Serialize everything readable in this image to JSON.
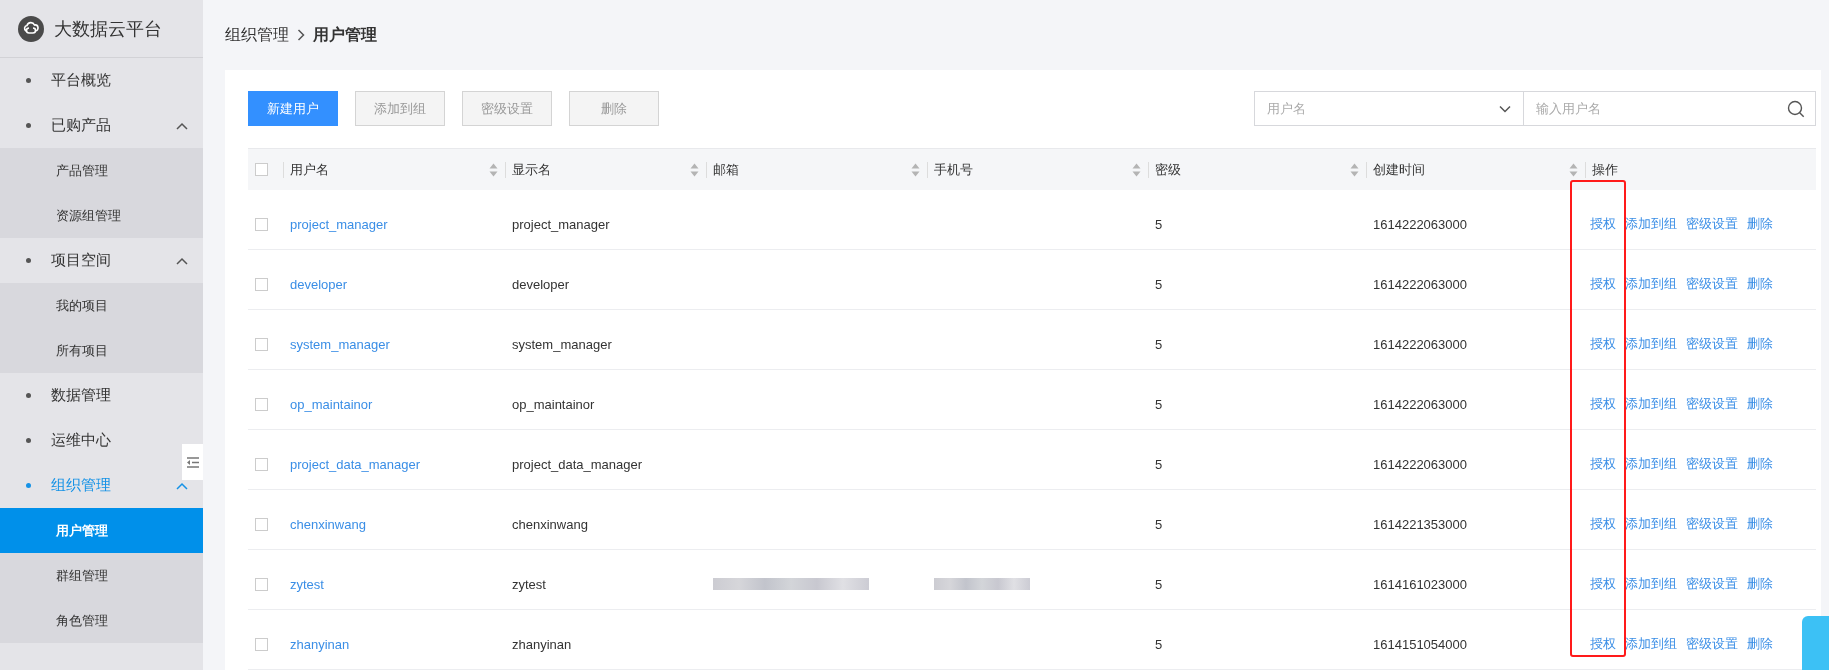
{
  "sidebar": {
    "brand": "大数据云平台",
    "items": [
      {
        "label": "平台概览",
        "selected": false
      },
      {
        "label": "已购产品",
        "selected": false,
        "expanded": true,
        "children": [
          {
            "label": "产品管理",
            "selected": false
          },
          {
            "label": "资源组管理",
            "selected": false
          }
        ]
      },
      {
        "label": "项目空间",
        "selected": false,
        "expanded": true,
        "children": [
          {
            "label": "我的项目",
            "selected": false
          },
          {
            "label": "所有项目",
            "selected": false
          }
        ]
      },
      {
        "label": "数据管理",
        "selected": false
      },
      {
        "label": "运维中心",
        "selected": false
      },
      {
        "label": "组织管理",
        "selected": true,
        "expanded": true,
        "children": [
          {
            "label": "用户管理",
            "selected": true
          },
          {
            "label": "群组管理",
            "selected": false
          },
          {
            "label": "角色管理",
            "selected": false
          }
        ]
      }
    ]
  },
  "breadcrumb": [
    "组织管理",
    "用户管理"
  ],
  "toolbar": {
    "buttons": [
      {
        "label": "新建用户",
        "kind": "primary"
      },
      {
        "label": "添加到组",
        "kind": "default"
      },
      {
        "label": "密级设置",
        "kind": "default"
      },
      {
        "label": "删除",
        "kind": "default"
      }
    ],
    "search": {
      "field_select": "用户名",
      "placeholder": "输入用户名"
    }
  },
  "table": {
    "select_all_checked": false,
    "columns": [
      {
        "label": "用户名",
        "sortable": true
      },
      {
        "label": "显示名",
        "sortable": true
      },
      {
        "label": "邮箱",
        "sortable": true
      },
      {
        "label": "手机号",
        "sortable": true
      },
      {
        "label": "密级",
        "sortable": true
      },
      {
        "label": "创建时间",
        "sortable": true
      },
      {
        "label": "操作",
        "sortable": false
      }
    ],
    "rows": [
      {
        "checked": false,
        "username": "project_manager",
        "display_name": "project_manager",
        "email_redacted": false,
        "phone_redacted": false,
        "level": "5",
        "created": "1614222063000",
        "actions": [
          "授权",
          "添加到组",
          "密级设置",
          "删除"
        ]
      },
      {
        "checked": false,
        "username": "developer",
        "display_name": "developer",
        "email_redacted": false,
        "phone_redacted": false,
        "level": "5",
        "created": "1614222063000",
        "actions": [
          "授权",
          "添加到组",
          "密级设置",
          "删除"
        ]
      },
      {
        "checked": false,
        "username": "system_manager",
        "display_name": "system_manager",
        "email_redacted": false,
        "phone_redacted": false,
        "level": "5",
        "created": "1614222063000",
        "actions": [
          "授权",
          "添加到组",
          "密级设置",
          "删除"
        ]
      },
      {
        "checked": false,
        "username": "op_maintainor",
        "display_name": "op_maintainor",
        "email_redacted": false,
        "phone_redacted": false,
        "level": "5",
        "created": "1614222063000",
        "actions": [
          "授权",
          "添加到组",
          "密级设置",
          "删除"
        ]
      },
      {
        "checked": false,
        "username": "project_data_manager",
        "display_name": "project_data_manager",
        "email_redacted": false,
        "phone_redacted": false,
        "level": "5",
        "created": "1614222063000",
        "actions": [
          "授权",
          "添加到组",
          "密级设置",
          "删除"
        ]
      },
      {
        "checked": false,
        "username": "chenxinwang",
        "display_name": "chenxinwang",
        "email_redacted": false,
        "phone_redacted": false,
        "level": "5",
        "created": "1614221353000",
        "actions": [
          "授权",
          "添加到组",
          "密级设置",
          "删除"
        ]
      },
      {
        "checked": false,
        "username": "zytest",
        "display_name": "zytest",
        "email_redacted": true,
        "phone_redacted": true,
        "level": "5",
        "created": "1614161023000",
        "actions": [
          "授权",
          "添加到组",
          "密级设置",
          "删除"
        ]
      },
      {
        "checked": false,
        "username": "zhanyinan",
        "display_name": "zhanyinan",
        "email_redacted": false,
        "phone_redacted": false,
        "level": "5",
        "created": "1614151054000",
        "actions": [
          "授权",
          "添加到组",
          "密级设置",
          "删除"
        ]
      }
    ]
  }
}
